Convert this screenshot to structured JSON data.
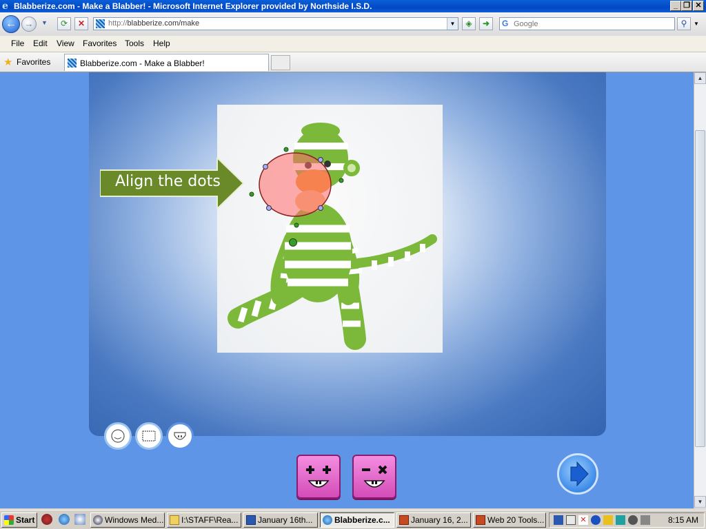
{
  "window": {
    "title": "Blabberize.com - Make a Blabber! - Microsoft Internet Explorer provided by Northside I.S.D.",
    "controls": [
      "_",
      "❐",
      "✕"
    ]
  },
  "nav": {
    "back": "back-arrow",
    "forward": "forward-arrow",
    "address_scheme": "http://",
    "address_rest": "blabberize.com/make",
    "search_placeholder": "Google",
    "search_engine_icon": "google-icon"
  },
  "menu": [
    "File",
    "Edit",
    "View",
    "Favorites",
    "Tools",
    "Help"
  ],
  "favorites": {
    "label": "Favorites"
  },
  "tabs": [
    {
      "label": "Blabberize.com - Make a Blabber!"
    }
  ],
  "page": {
    "instruction": "Align the dots",
    "tools": [
      "face-tool",
      "crop-tool",
      "mouth-tool"
    ],
    "add_button": "add-mouth",
    "remove_button": "remove-mouth",
    "next_button": "next"
  },
  "taskbar": {
    "start": "Start",
    "tasks": [
      {
        "label": "Windows Med...",
        "active": false
      },
      {
        "label": "I:\\STAFF\\Rea...",
        "active": false
      },
      {
        "label": "January 16th...",
        "active": false
      },
      {
        "label": "Blabberize.c...",
        "active": true
      },
      {
        "label": "January 16, 2...",
        "active": false
      },
      {
        "label": "Web 20 Tools...",
        "active": false
      }
    ],
    "clock": "8:15 AM"
  }
}
